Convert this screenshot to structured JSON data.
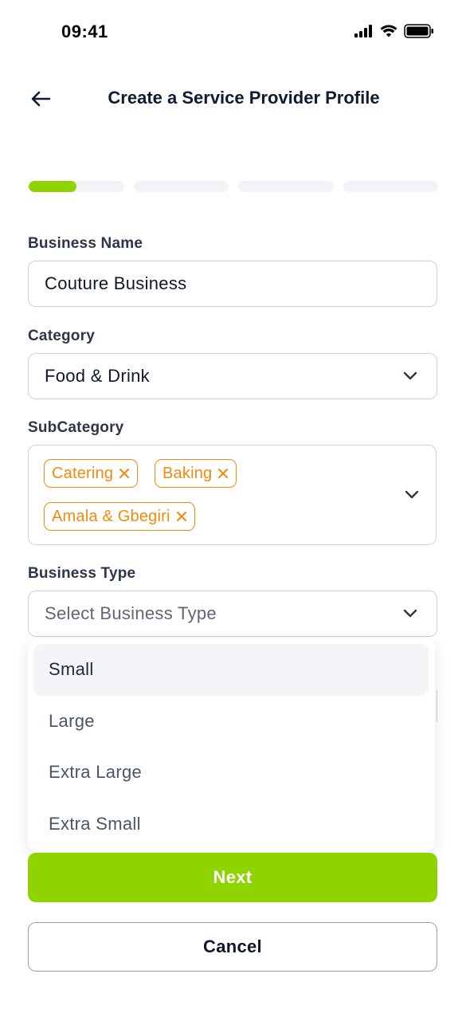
{
  "status_bar": {
    "time": "09:41",
    "icons": [
      "cellular-signal-icon",
      "wifi-icon",
      "battery-icon"
    ]
  },
  "header": {
    "back_icon": "arrow-left-icon",
    "title": "Create a Service Provider Profile"
  },
  "progress": {
    "total_steps": 4,
    "current_step": 1,
    "current_step_fill": 0.5,
    "colors": {
      "active": "#8fd400",
      "track": "#f1f3f6"
    }
  },
  "form": {
    "business_name": {
      "label": "Business Name",
      "value": "Couture Business"
    },
    "category": {
      "label": "Category",
      "value": "Food & Drink",
      "icon": "chevron-down-icon"
    },
    "subcategory": {
      "label": "SubCategory",
      "chips": [
        {
          "label": "Catering"
        },
        {
          "label": "Baking"
        },
        {
          "label": "Amala & Gbegiri"
        }
      ],
      "chip_icon": "close-icon",
      "icon": "chevron-down-icon"
    },
    "business_type": {
      "label": "Business Type",
      "placeholder": "Select Business Type",
      "icon": "chevron-down-icon",
      "options": [
        "Small",
        "Large",
        "Extra Large",
        "Extra Small"
      ],
      "highlighted_option": "Small"
    }
  },
  "actions": {
    "next_label": "Next",
    "cancel_label": "Cancel"
  },
  "colors": {
    "accent": "#8fd400",
    "chip": "#f28a0d",
    "title": "#0f1b33",
    "border": "#cbd2dc"
  }
}
